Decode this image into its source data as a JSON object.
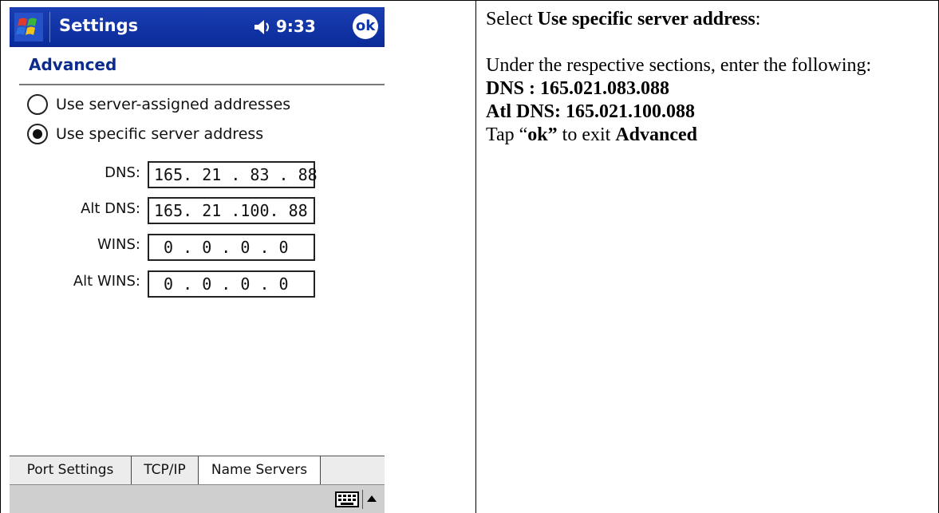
{
  "device": {
    "title": "Settings",
    "clock": "9:33",
    "ok_label": "ok",
    "section_title": "Advanced",
    "radios": [
      {
        "label": "Use server-assigned addresses",
        "checked": false
      },
      {
        "label": "Use specific server address",
        "checked": true
      }
    ],
    "fields": [
      {
        "label": "DNS:",
        "value": "165. 21 . 83 . 88"
      },
      {
        "label": "Alt DNS:",
        "value": "165. 21 .100. 88"
      },
      {
        "label": "WINS:",
        "value": " 0 . 0 . 0 . 0"
      },
      {
        "label": "Alt WINS:",
        "value": " 0 . 0 . 0 . 0"
      }
    ],
    "tabs": [
      {
        "label": "Port Settings",
        "active": false
      },
      {
        "label": "TCP/IP",
        "active": false
      },
      {
        "label": "Name Servers",
        "active": true
      }
    ],
    "icons": [
      "windows-start-icon",
      "speaker-icon",
      "ok-button",
      "keyboard-icon",
      "arrow-up-icon"
    ]
  },
  "instructions": {
    "line1_prefix": "Select ",
    "line1_bold": "Use specific server address",
    "line1_suffix": ":",
    "line2": "Under the respective sections, enter the following:",
    "dns_line": "DNS : 165.021.083.088",
    "alt_dns_line": "Atl DNS: 165.021.100.088",
    "tap_prefix": "Tap “",
    "tap_bold": "ok”",
    "tap_mid": " to exit ",
    "tap_bold2": "Advanced"
  }
}
